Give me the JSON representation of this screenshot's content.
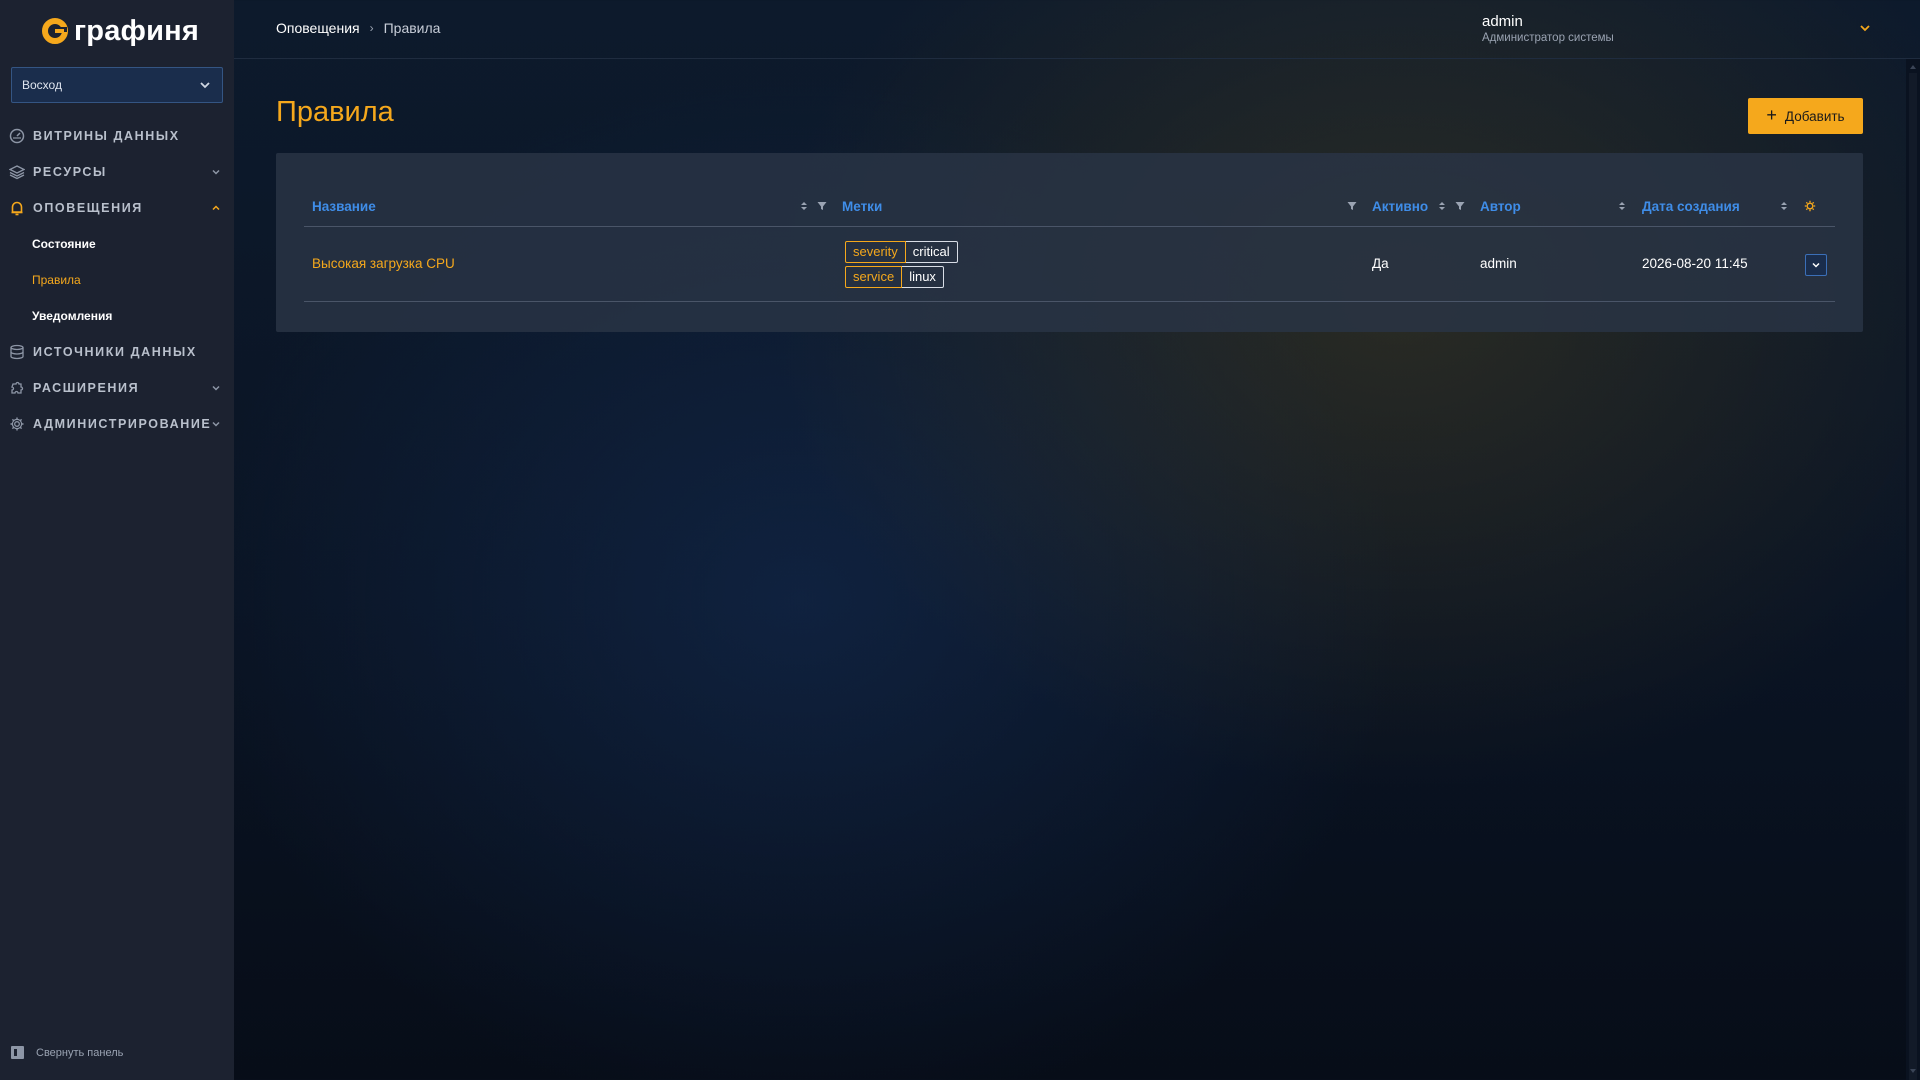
{
  "app": {
    "logo_text": "графиня"
  },
  "sidebar": {
    "org_select": {
      "value": "Восход"
    },
    "items": [
      {
        "label": "Витрины данных",
        "icon": "dashboard-gauge-icon"
      },
      {
        "label": "Ресурсы",
        "icon": "layers-icon"
      },
      {
        "label": "Оповещения",
        "icon": "bell-icon"
      },
      {
        "label": "Источники данных",
        "icon": "database-icon"
      },
      {
        "label": "Расширения",
        "icon": "plugin-icon"
      },
      {
        "label": "Администрирование",
        "icon": "gear-icon"
      }
    ],
    "alerts_subitems": [
      {
        "label": "Состояние"
      },
      {
        "label": "Правила"
      },
      {
        "label": "Уведомления"
      }
    ],
    "collapse_label": "Свернуть панель"
  },
  "topbar": {
    "breadcrumb": [
      "Оповещения",
      "Правила"
    ],
    "user": {
      "name": "admin",
      "role": "Администратор системы"
    }
  },
  "page": {
    "title": "Правила",
    "add_button": "Добавить"
  },
  "table": {
    "columns": [
      "Название",
      "Метки",
      "Активно",
      "Автор",
      "Дата создания"
    ],
    "rows": [
      {
        "name": "Высокая загрузка CPU",
        "labels": [
          {
            "key": "severity",
            "value": "critical"
          },
          {
            "key": "service",
            "value": "linux"
          }
        ],
        "active": "Да",
        "author": "admin",
        "created": "2026-08-20 11:45"
      }
    ]
  },
  "colors": {
    "accent": "#f5a81c",
    "link_blue": "#3f8de8",
    "sidebar_bg": "#1c2230",
    "panel_bg": "#2a3446"
  }
}
